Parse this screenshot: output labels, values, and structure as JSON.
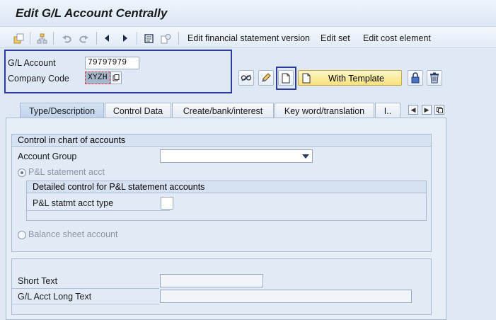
{
  "window": {
    "title": "Edit G/L Account Centrally"
  },
  "toolbar": {
    "links": [
      "Edit financial statement version",
      "Edit set",
      "Edit cost element"
    ]
  },
  "header": {
    "gl_account_label": "G/L Account",
    "gl_account_value": "79797979",
    "company_code_label": "Company Code",
    "company_code_value": "XYZH"
  },
  "actions": {
    "with_template_label": "With Template"
  },
  "tabs": [
    {
      "label": "Type/Description",
      "active": true
    },
    {
      "label": "Control Data",
      "active": false
    },
    {
      "label": "Create/bank/interest",
      "active": false
    },
    {
      "label": "Key word/translation",
      "active": false
    },
    {
      "label": "I..",
      "active": false
    }
  ],
  "control_group": {
    "title": "Control in chart of accounts",
    "account_group_label": "Account Group",
    "account_group_value": "",
    "pl_radio_label": "P&L statement acct",
    "pl_radio_selected": true,
    "detail_group_title": "Detailed control for P&L statement accounts",
    "pl_type_label": "P&L statmt acct type",
    "pl_type_value": "",
    "balance_radio_label": "Balance sheet account"
  },
  "text_group": {
    "short_text_label": "Short Text",
    "short_text_value": "",
    "long_text_label": "G/L Acct Long Text",
    "long_text_value": ""
  },
  "colors": {
    "highlight": "#2f3a9e",
    "template_button": "#f8e17e",
    "background": "#dfe9f5"
  }
}
